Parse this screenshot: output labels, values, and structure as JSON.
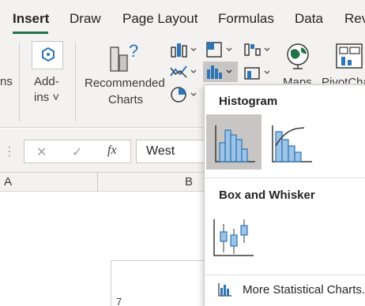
{
  "ribbon_tabs": [
    "Insert",
    "Draw",
    "Page Layout",
    "Formulas",
    "Data",
    "Rev"
  ],
  "active_tab": "Insert",
  "ribbon": {
    "left_cut_label": "ns",
    "addins_line1": "Add-",
    "addins_line2": "ins ˅",
    "recommended_line1": "Recommended",
    "recommended_line2": "Charts",
    "maps_label": "Maps",
    "pivot_label": "PivotCha"
  },
  "formula_bar": {
    "cancel_glyph": "✕",
    "enter_glyph": "✓",
    "fx_glyph": "fx",
    "value": "West"
  },
  "columns": [
    "A",
    "B"
  ],
  "row_label_partial": "7",
  "dropdown": {
    "histogram_heading": "Histogram",
    "box_whisker_heading": "Box and Whisker",
    "more_link": "More Statistical Charts..."
  },
  "colors": {
    "accent_green": "#217346",
    "chart_blue": "#2e75b6",
    "chart_fill": "#9dc3e6",
    "selected_bg": "#c8c6c4"
  }
}
